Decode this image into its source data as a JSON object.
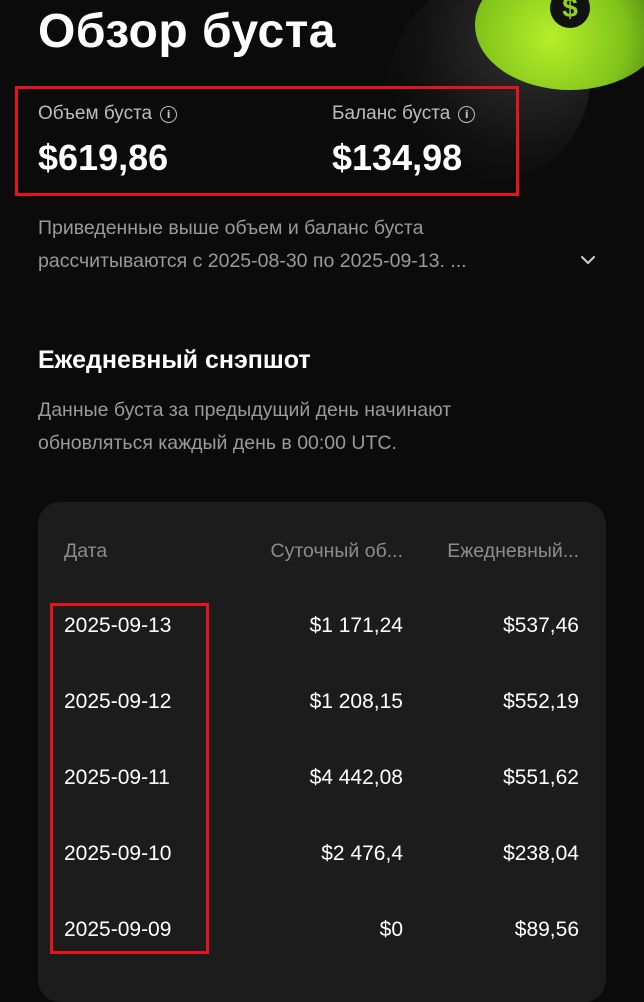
{
  "header": {
    "title": "Обзор буста"
  },
  "stats": {
    "volume": {
      "label": "Объем буста",
      "value": "$619,86"
    },
    "balance": {
      "label": "Баланс буста",
      "value": "$134,98"
    }
  },
  "note": {
    "line1": "Приведенные выше объем и баланс буста",
    "line2": "рассчитываются с 2025-08-30 по 2025-09-13. ..."
  },
  "snapshot": {
    "title": "Ежедневный снэпшот",
    "subtitle_line1": "Данные буста за предыдущий день начинают",
    "subtitle_line2": "обновляться каждый день в 00:00 UTC.",
    "columns": {
      "date": "Дата",
      "daily_volume": "Суточный об...",
      "daily_balance": "Ежедневный..."
    },
    "rows": [
      {
        "date": "2025-09-13",
        "volume": "$1 171,24",
        "balance": "$537,46"
      },
      {
        "date": "2025-09-12",
        "volume": "$1 208,15",
        "balance": "$552,19"
      },
      {
        "date": "2025-09-11",
        "volume": "$4 442,08",
        "balance": "$551,62"
      },
      {
        "date": "2025-09-10",
        "volume": "$2 476,4",
        "balance": "$238,04"
      },
      {
        "date": "2025-09-09",
        "volume": "$0",
        "balance": "$89,56"
      }
    ]
  },
  "icons": {
    "info": "info-icon",
    "expand": "chevron-down-icon",
    "coin": "dollar-coin-icon"
  },
  "colors": {
    "background": "#0b0b0b",
    "card": "#1c1c1c",
    "highlight": "#e5131d",
    "accent_green": "#8fd11f"
  }
}
